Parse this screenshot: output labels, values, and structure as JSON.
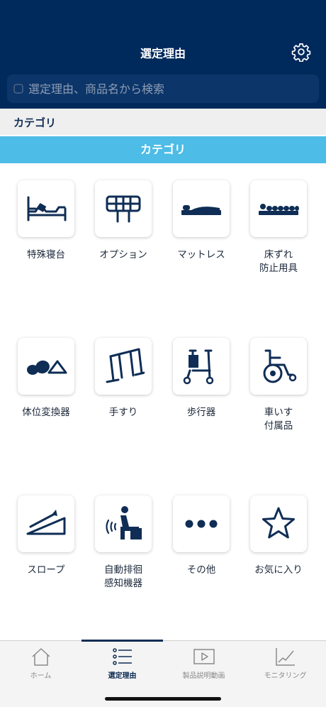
{
  "header": {
    "title": "選定理由",
    "settings_icon": "gear-icon"
  },
  "search": {
    "placeholder": "選定理由、商品名から検索",
    "icon": "search-icon"
  },
  "section": {
    "title": "カテゴリ"
  },
  "category_bar": {
    "label": "カテゴリ",
    "color": "#4dbce6"
  },
  "colors": {
    "header_bg": "#00295c",
    "icon_navy": "#0f2d55"
  },
  "categories": [
    {
      "label": "特殊寝台",
      "icon": "care-bed-icon"
    },
    {
      "label": "オプション",
      "icon": "bed-rail-icon"
    },
    {
      "label": "マットレス",
      "icon": "mattress-icon"
    },
    {
      "label": "床ずれ\n防止用具",
      "icon": "pressure-mattress-icon"
    },
    {
      "label": "体位変換器",
      "icon": "positioning-cushion-icon"
    },
    {
      "label": "手すり",
      "icon": "handrail-icon"
    },
    {
      "label": "歩行器",
      "icon": "walker-icon"
    },
    {
      "label": "車いす\n付属品",
      "icon": "wheelchair-icon"
    },
    {
      "label": "スロープ",
      "icon": "slope-icon"
    },
    {
      "label": "自動排徊\n感知機器",
      "icon": "sensor-person-icon"
    },
    {
      "label": "その他",
      "icon": "more-dots-icon"
    },
    {
      "label": "お気に入り",
      "icon": "star-icon"
    }
  ],
  "tabs": [
    {
      "label": "ホーム",
      "icon": "home-icon",
      "active": false
    },
    {
      "label": "選定理由",
      "icon": "list-icon",
      "active": true
    },
    {
      "label": "製品説明動画",
      "icon": "video-play-icon",
      "active": false
    },
    {
      "label": "モニタリング",
      "icon": "chart-line-icon",
      "active": false
    }
  ]
}
